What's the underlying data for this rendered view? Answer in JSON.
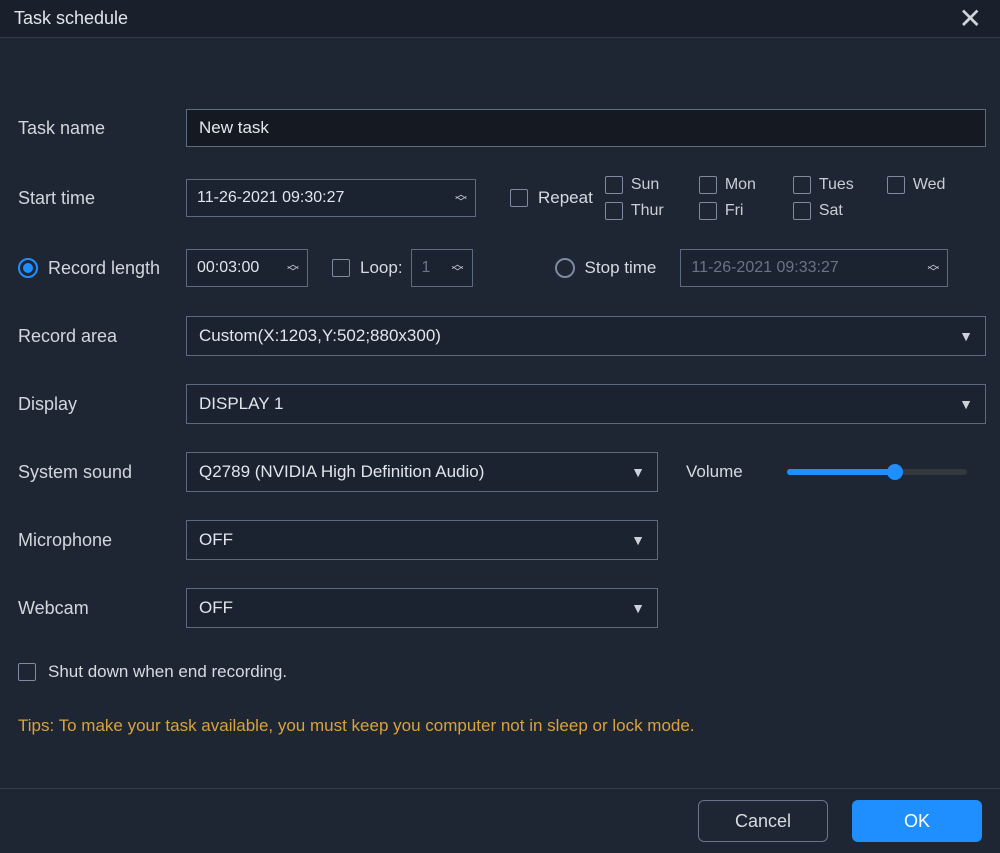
{
  "window": {
    "title": "Task schedule"
  },
  "labels": {
    "task_name": "Task name",
    "start_time": "Start time",
    "repeat": "Repeat",
    "record_length": "Record length",
    "loop": "Loop:",
    "stop_time": "Stop time",
    "record_area": "Record area",
    "display": "Display",
    "system_sound": "System sound",
    "volume": "Volume",
    "microphone": "Microphone",
    "webcam": "Webcam",
    "shutdown": "Shut down when end recording.",
    "tips": "Tips: To make your task available, you must keep you computer not in sleep or lock mode.",
    "cancel": "Cancel",
    "ok": "OK"
  },
  "values": {
    "task_name": "New task",
    "start_time": "11-26-2021 09:30:27",
    "record_length": "00:03:00",
    "loop": "1",
    "stop_time": "11-26-2021 09:33:27",
    "record_area": "Custom(X:1203,Y:502;880x300)",
    "display": "DISPLAY 1",
    "system_sound": "Q2789 (NVIDIA High Definition Audio)",
    "microphone": "OFF",
    "webcam": "OFF",
    "volume_percent": 60
  },
  "days": {
    "sun": "Sun",
    "mon": "Mon",
    "tues": "Tues",
    "wed": "Wed",
    "thur": "Thur",
    "fri": "Fri",
    "sat": "Sat"
  }
}
